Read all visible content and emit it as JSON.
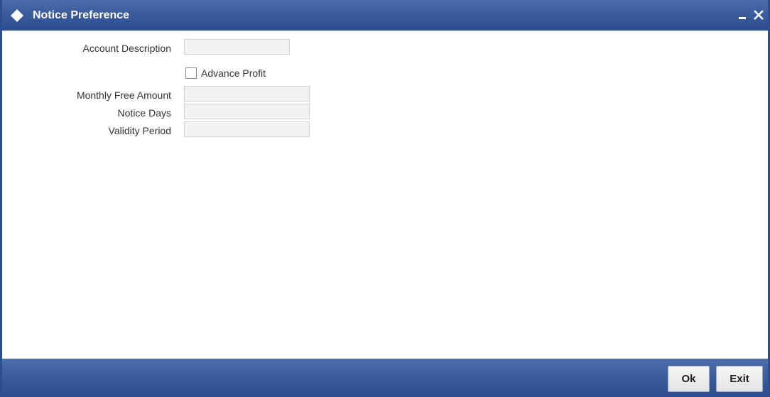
{
  "window": {
    "title": "Notice Preference",
    "minimize_icon": "minimize-icon",
    "close_icon": "close-icon",
    "title_icon": "diamond-icon"
  },
  "form": {
    "account_description": {
      "label": "Account Description",
      "value": ""
    },
    "advance_profit": {
      "label": "Advance Profit",
      "checked": false
    },
    "monthly_free_amount": {
      "label": "Monthly Free Amount",
      "value": ""
    },
    "notice_days": {
      "label": "Notice Days",
      "value": ""
    },
    "validity_period": {
      "label": "Validity Period",
      "value": ""
    }
  },
  "footer": {
    "ok_label": "Ok",
    "exit_label": "Exit"
  },
  "colors": {
    "titlebar": "#2c4d8f",
    "footer": "#3a5b9c",
    "input_bg": "#f2f2f2",
    "text": "#333333"
  }
}
